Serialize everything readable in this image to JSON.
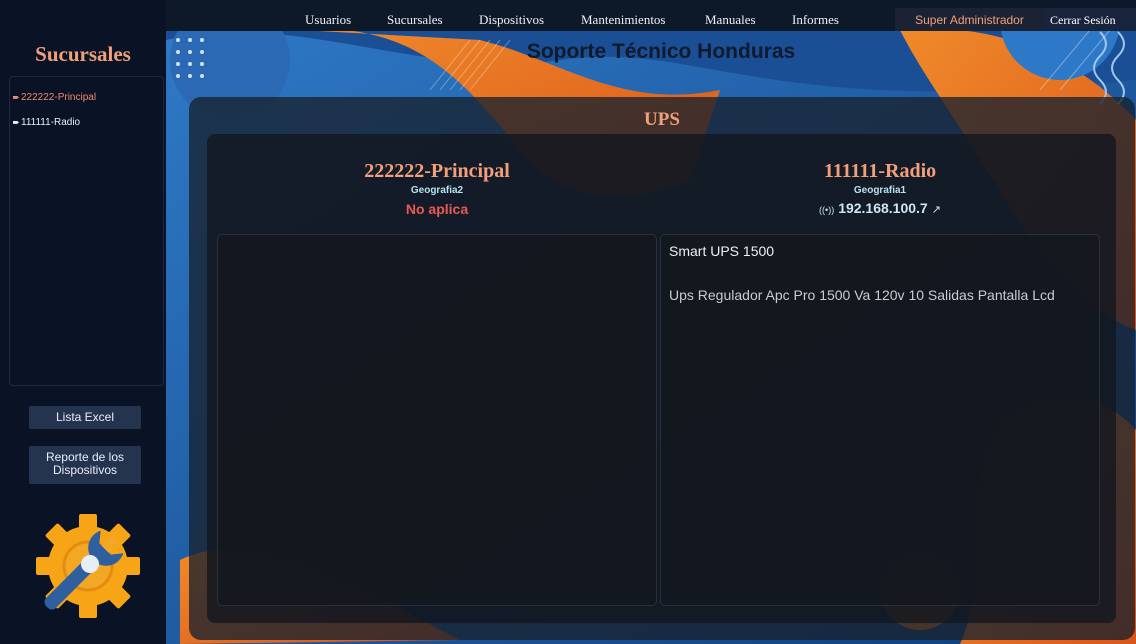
{
  "nav": {
    "items": [
      {
        "label": "Usuarios"
      },
      {
        "label": "Sucursales"
      },
      {
        "label": "Dispositivos"
      },
      {
        "label": "Mantenimientos"
      },
      {
        "label": "Manuales"
      },
      {
        "label": "Informes"
      }
    ],
    "user": "Super Administrador",
    "logout": "Cerrar Sesión"
  },
  "site_title": "Soporte Técnico Honduras",
  "sidebar": {
    "title": "Sucursales",
    "branches": [
      {
        "label": "222222-Principal",
        "active": true
      },
      {
        "label": "111111-Radio",
        "active": false
      }
    ],
    "excel_button": "Lista Excel",
    "report_button": "Reporte de los Dispositivos"
  },
  "main": {
    "section_title": "UPS",
    "left": {
      "name": "222222-Principal",
      "geo": "Geografia2",
      "status": "No aplica"
    },
    "right": {
      "name": "111111-Radio",
      "geo": "Geografia1",
      "ip": "192.168.100.7",
      "model": "Smart UPS 1500",
      "description": "Ups Regulador Apc Pro 1500 Va 120v 10 Salidas Pantalla Lcd"
    }
  },
  "colors": {
    "accent": "#f3a07a",
    "alert": "#ea5a54",
    "bg_blue": "#1e5aa8",
    "bg_orange": "#e8741f"
  },
  "icons": {
    "logo": "gear-wrench-icon",
    "signal": "signal-icon",
    "external_link": "external-link-icon"
  }
}
